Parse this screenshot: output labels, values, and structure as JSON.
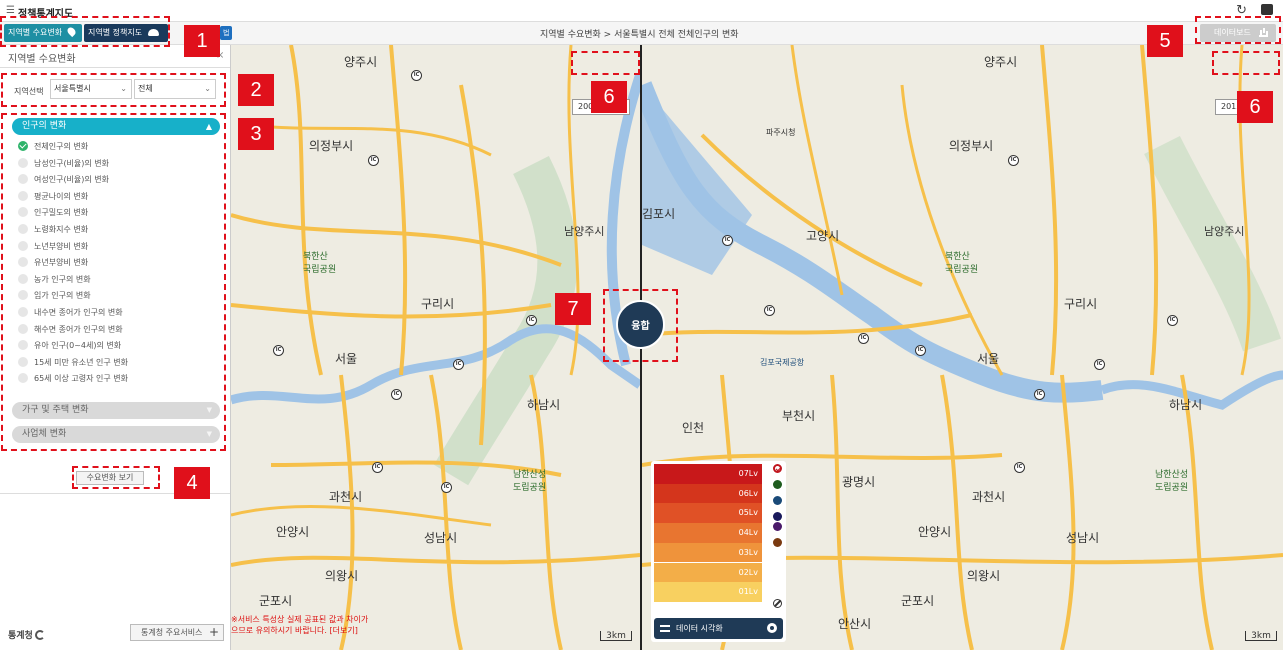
{
  "header": {
    "app_title": "정책통계지도",
    "btn_region_demand": "지역별 수요변화",
    "btn_region_policy": "지역별 정책지도",
    "blue_tag": "법",
    "breadcrumb": "지역별 수요변화 > 서울특별시 전체 전체인구의 변화",
    "dashboard_label": "데이터보드"
  },
  "panel": {
    "title": "지역별 수요변화",
    "close": "×",
    "region_label": "지역선택",
    "region_value": "서울특별시",
    "district_value": "전체",
    "open_category": "인구의 변화",
    "items": [
      "전체인구의 변화",
      "남성인구(비율)의 변화",
      "여성인구(비율)의 변화",
      "평균나이의 변화",
      "인구밀도의 변화",
      "노령화지수 변화",
      "노년부양비 변화",
      "유년부양비 변화",
      "농가 인구의 변화",
      "임가 인구의 변화",
      "내수면 종어가 인구의 변화",
      "해수면 종어가 인구의 변화",
      "유아 인구(0~4세)의 변화",
      "15세 미만 유소년 인구 변화",
      "65세 이상 고령자 인구 변화"
    ],
    "category_household": "가구 및 주택 변화",
    "category_business": "사업체 변화",
    "view_button": "수요변화 보기",
    "logo_text": "통계청",
    "services_label": "통계청 주요서비스",
    "services_plus": "+"
  },
  "left_map": {
    "year": "2000년",
    "scale": "3km",
    "labels": [
      "양주시",
      "의정부시",
      "남양주시",
      "북한산\n국립공원",
      "구리시",
      "서울",
      "하남시",
      "과천시",
      "안양시",
      "성남시",
      "의왕시",
      "군포시",
      "남한산성\n도립공원"
    ]
  },
  "right_map": {
    "year": "2015년",
    "scale": "3km",
    "labels": [
      "양주시",
      "의정부시",
      "파주시청",
      "김포시",
      "고양시",
      "남양주시",
      "북한산\n국립공원",
      "구리시",
      "서울",
      "하남시",
      "부천시",
      "인천",
      "광명시",
      "과천시",
      "안양시",
      "성남시",
      "의왕시",
      "군포시",
      "안산시",
      "김포국제공항",
      "남한산성\n도립공원"
    ]
  },
  "fusion_button": "융합",
  "legend": {
    "levels": [
      {
        "label": "07Lv",
        "color": "#c8181a"
      },
      {
        "label": "06Lv",
        "color": "#d4351c"
      },
      {
        "label": "05Lv",
        "color": "#e05126"
      },
      {
        "label": "04Lv",
        "color": "#e87530"
      },
      {
        "label": "03Lv",
        "color": "#ef933b"
      },
      {
        "label": "02Lv",
        "color": "#f3ae48"
      },
      {
        "label": "01Lv",
        "color": "#f8d060"
      }
    ],
    "palette": [
      "#c0161e",
      "#1e5c1e",
      "#1a4a78",
      "#1a1a5c",
      "#4a1a6a",
      "#7a3a10"
    ],
    "footer_label": "데이터 시각화"
  },
  "notice": {
    "line1": "※서비스 특성상 실제 공표된 값과 차이가",
    "line2": "으므로 유의하시기 바랍니다. [더보기]"
  },
  "annotations": [
    "1",
    "2",
    "3",
    "4",
    "5",
    "6",
    "6",
    "7"
  ]
}
